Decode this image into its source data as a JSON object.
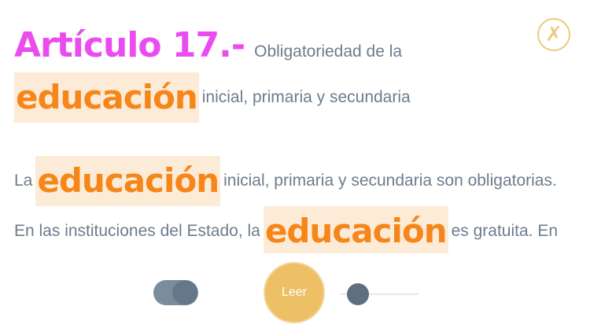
{
  "header": {
    "article_label": "Artículo 17.-",
    "heading_text": "Obligatoriedad de la",
    "line1_highlight": "educación",
    "line1_text": "inicial, primaria y secundaria"
  },
  "body": {
    "line2_prefix": "La",
    "line2_highlight": "educación",
    "line2_text": "inicial, primaria y secundaria son obligatorias.",
    "line3_prefix": "En las instituciones del Estado, la",
    "line3_highlight": "educación",
    "line3_text": "es gratuita. En"
  },
  "controls": {
    "close_glyph": "✗",
    "read_label": "Leer",
    "toggle_on": true,
    "slider_level": 0.23
  },
  "colors": {
    "article_label": "#ea4cf0",
    "highlight_text": "#f6861a",
    "highlight_bg": "#fcebd6",
    "body_text": "#6e7c8c",
    "accent": "#eec066"
  },
  "icons": {
    "close": "close-icon"
  }
}
